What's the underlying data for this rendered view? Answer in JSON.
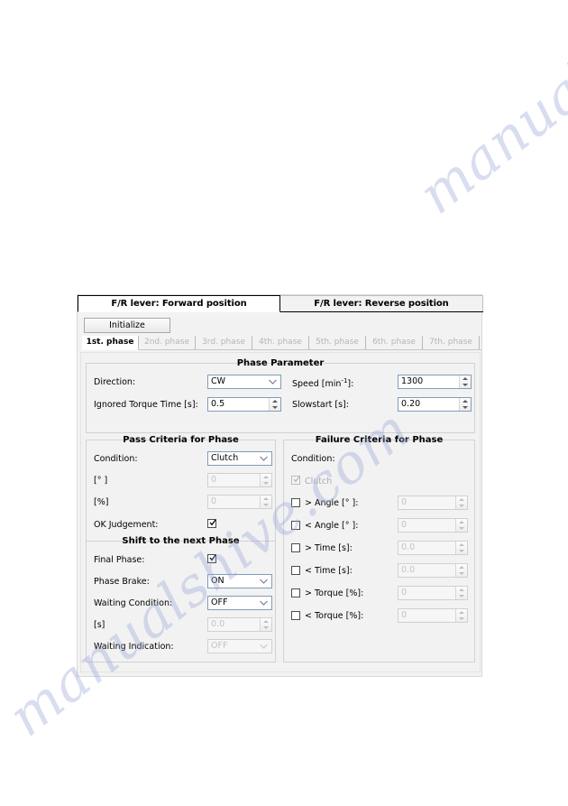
{
  "window": {
    "lever_tabs": [
      {
        "label": "F/R lever: Forward position",
        "active": true
      },
      {
        "label": "F/R lever: Reverse position",
        "active": false
      }
    ],
    "initialize_button": "Initialize",
    "phase_tabs": [
      {
        "label": "1st. phase",
        "active": true
      },
      {
        "label": "2nd. phase",
        "active": false
      },
      {
        "label": "3rd. phase",
        "active": false
      },
      {
        "label": "4th. phase",
        "active": false
      },
      {
        "label": "5th. phase",
        "active": false
      },
      {
        "label": "6th. phase",
        "active": false
      },
      {
        "label": "7th. phase",
        "active": false
      }
    ]
  },
  "phase_parameter": {
    "title": "Phase Parameter",
    "direction_label": "Direction:",
    "direction_value": "CW",
    "ignored_torque_time_label": "Ignored Torque Time [s]:",
    "ignored_torque_time_value": "0.5",
    "speed_label_prefix": "Speed [min",
    "speed_label_sup": "-1",
    "speed_label_suffix": "]:",
    "speed_value": "1300",
    "slowstart_label": "Slowstart [s]:",
    "slowstart_value": "0.20"
  },
  "pass_criteria": {
    "title": "Pass Criteria for Phase",
    "condition_label": "Condition:",
    "condition_value": "Clutch",
    "angle_label": "[° ]",
    "angle_value": "0",
    "percent_label": "[%]",
    "percent_value": "0",
    "ok_judgement_label": "OK Judgement:",
    "ok_judgement_checked": true
  },
  "shift_next_phase": {
    "title": "Shift to the next Phase",
    "final_phase_label": "Final Phase:",
    "final_phase_checked": true,
    "phase_brake_label": "Phase Brake:",
    "phase_brake_value": "ON",
    "waiting_condition_label": "Waiting Condition:",
    "waiting_condition_value": "OFF",
    "seconds_label": "[s]",
    "seconds_value": "0.0",
    "waiting_indication_label": "Waiting Indication:",
    "waiting_indication_value": "OFF"
  },
  "failure_criteria": {
    "title": "Failure Criteria for Phase",
    "condition_label": "Condition:",
    "clutch_label": "Clutch",
    "clutch_checked": true,
    "rows": [
      {
        "label": "> Angle [° ]:",
        "checked": false,
        "value": "0"
      },
      {
        "label": "< Angle [° ]:",
        "checked": false,
        "value": "0"
      },
      {
        "label": "> Time [s]:",
        "checked": false,
        "value": "0.0"
      },
      {
        "label": "< Time [s]:",
        "checked": false,
        "value": "0.0"
      },
      {
        "label": "> Torque [%]:",
        "checked": false,
        "value": "0"
      },
      {
        "label": "< Torque [%]:",
        "checked": false,
        "value": "0"
      }
    ]
  },
  "watermark": {
    "line_a": "manualshive.com",
    "line_b": "manualshive.com"
  },
  "colors": {
    "dialog_bg": "#f2f2f2",
    "field_border": "#7f9db9",
    "disabled_text": "#c2c2c2",
    "watermark": "#9aa7d8"
  }
}
